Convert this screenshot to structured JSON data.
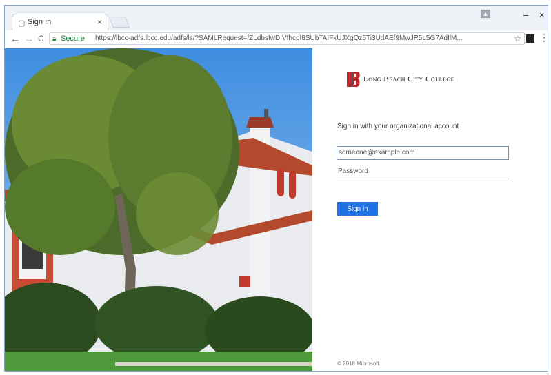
{
  "browser": {
    "tab_title": "Sign In",
    "tab_close": "×",
    "user_badge": "▲",
    "minimize": "–",
    "close": "×",
    "back": "←",
    "forward": "→",
    "reload": "C",
    "secure_label": "Secure",
    "url": "https://lbcc-adfs.lbcc.edu/adfs/ls/?SAMLRequest=fZLdbsIwDIVfhcpI8SUbTAIFkUJXgQz5Ti3UdAEf9MwJR5L5G7AdIlM...",
    "star": "☆",
    "menu": "⋮"
  },
  "panel": {
    "logo_text": "Long Beach City College",
    "prompt": "Sign in with your organizational account",
    "username_placeholder": "someone@example.com",
    "password_placeholder": "Password",
    "signin_label": "Sign in",
    "footer": "© 2018 Microsoft"
  },
  "colors": {
    "brand_red": "#c0282d",
    "button_blue": "#1f6fe5"
  }
}
